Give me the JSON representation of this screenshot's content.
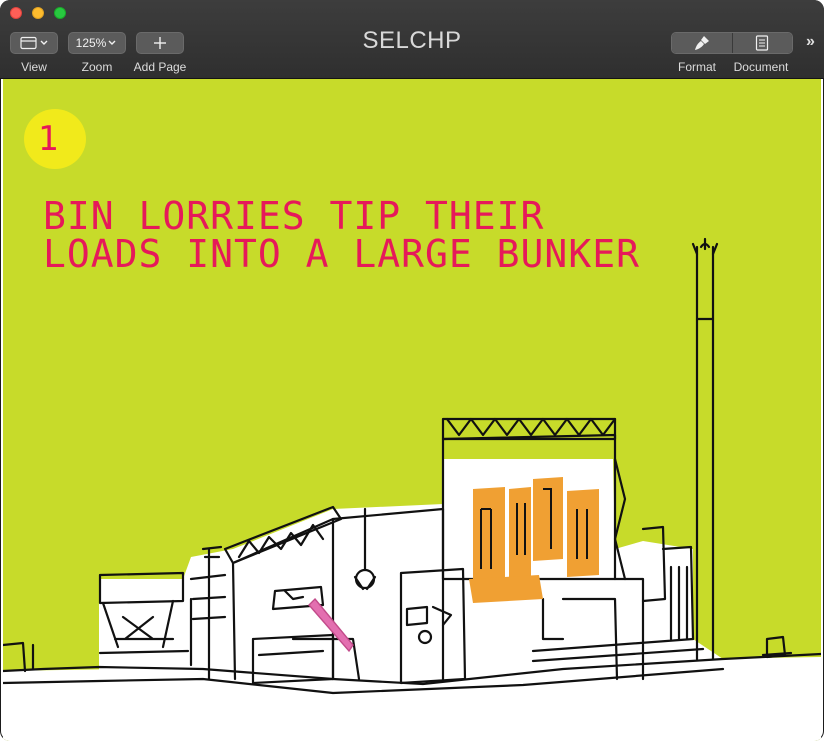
{
  "window": {
    "title": "SELCHP"
  },
  "toolbar": {
    "view_label": "View",
    "zoom_value": "125%",
    "zoom_label": "Zoom",
    "add_page_label": "Add Page",
    "format_label": "Format",
    "document_label": "Document"
  },
  "page": {
    "step_number": "1",
    "headline_line1": "BIN LORRIES TIP THEIR",
    "headline_line2": "LOADS INTO A LARGE BUNKER"
  },
  "colors": {
    "page_background": "#c7db2a",
    "accent_text": "#e6195a",
    "badge": "#f1ea1b",
    "boiler_fill": "#f0a033"
  }
}
